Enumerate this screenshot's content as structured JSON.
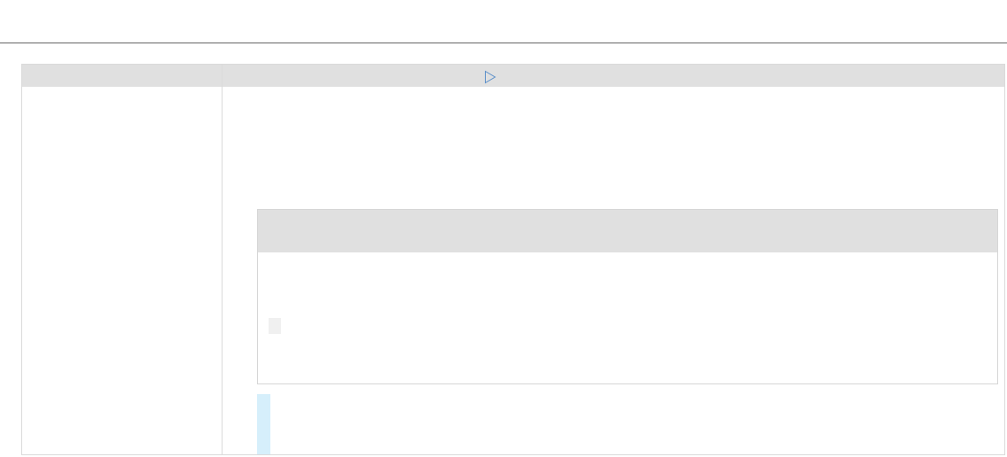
{
  "header": {
    "play_icon": "play-outline-icon"
  },
  "colors": {
    "rule": "#666666",
    "header_background": "#e0e0e0",
    "border": "#dadada",
    "play_icon_stroke": "#5b8fc9",
    "highlight": "#d6effb",
    "chip": "#f0f0f0"
  }
}
